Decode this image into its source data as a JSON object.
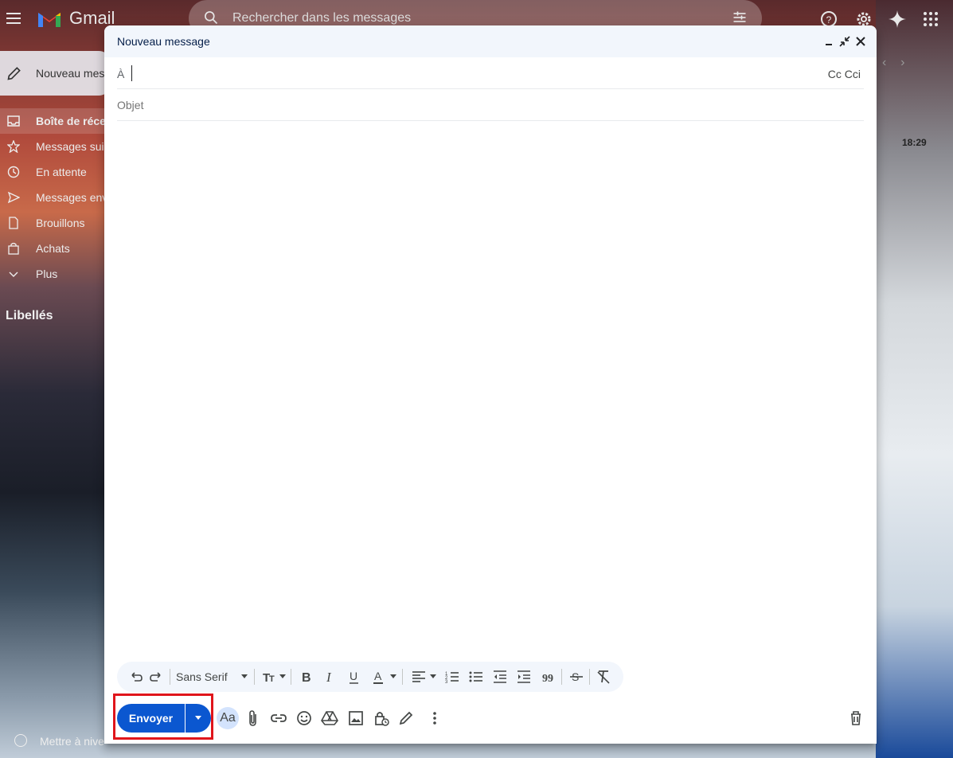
{
  "app": {
    "name": "Gmail"
  },
  "search": {
    "placeholder": "Rechercher dans les messages"
  },
  "sidebar": {
    "compose_label": "Nouveau mes",
    "items": [
      {
        "label": "Boîte de réce",
        "icon": "inbox-icon",
        "active": true
      },
      {
        "label": "Messages sui",
        "icon": "star-icon"
      },
      {
        "label": "En attente",
        "icon": "clock-icon"
      },
      {
        "label": "Messages env",
        "icon": "send-icon"
      },
      {
        "label": "Brouillons",
        "icon": "draft-icon"
      },
      {
        "label": "Achats",
        "icon": "shopping-icon"
      },
      {
        "label": "Plus",
        "icon": "chevron-down-icon"
      }
    ],
    "labels_title": "Libellés",
    "upgrade_label": "Mettre à nive"
  },
  "inbox": {
    "visible_time": "18:29"
  },
  "compose": {
    "title": "Nouveau message",
    "to_label": "À",
    "to_value": "",
    "cc_bcc": "Cc Cci",
    "subject_placeholder": "Objet",
    "subject_value": "",
    "body": "",
    "font": "Sans Serif",
    "send_label": "Envoyer",
    "aa_label": "Aa"
  },
  "colors": {
    "send_button": "#0b57d0",
    "header_bg": "#f2f6fc",
    "highlight_box": "#e0151b"
  }
}
